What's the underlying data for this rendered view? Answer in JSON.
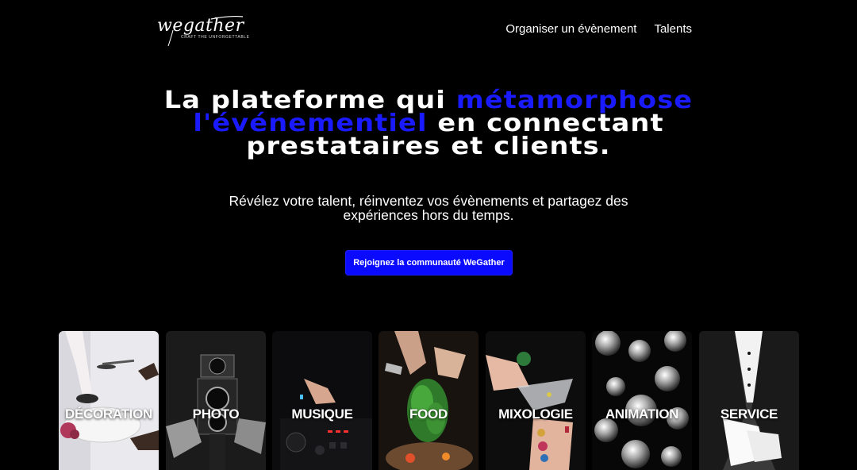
{
  "header": {
    "logo_text": "wegather",
    "logo_tagline": "CRAFT THE UNFORGETTABLE",
    "nav": [
      {
        "label": "Organiser un évènement"
      },
      {
        "label": "Talents"
      }
    ]
  },
  "hero": {
    "title_part1": "La plateforme qui ",
    "title_accent": "métamorphose l'événementiel",
    "title_part2": " en connectant prestataires et clients.",
    "subtitle": "Révélez votre talent, réinventez vos évènements et partagez des expériences hors du temps.",
    "cta_label": "Rejoignez la communauté WeGather"
  },
  "categories": [
    {
      "label": "DÉCORATION"
    },
    {
      "label": "PHOTO"
    },
    {
      "label": "MUSIQUE"
    },
    {
      "label": "FOOD"
    },
    {
      "label": "MIXOLOGIE"
    },
    {
      "label": "ANIMATION"
    },
    {
      "label": "SERVICE"
    }
  ],
  "colors": {
    "background": "#000000",
    "accent": "#1a1aff",
    "cta": "#0a0aff"
  }
}
